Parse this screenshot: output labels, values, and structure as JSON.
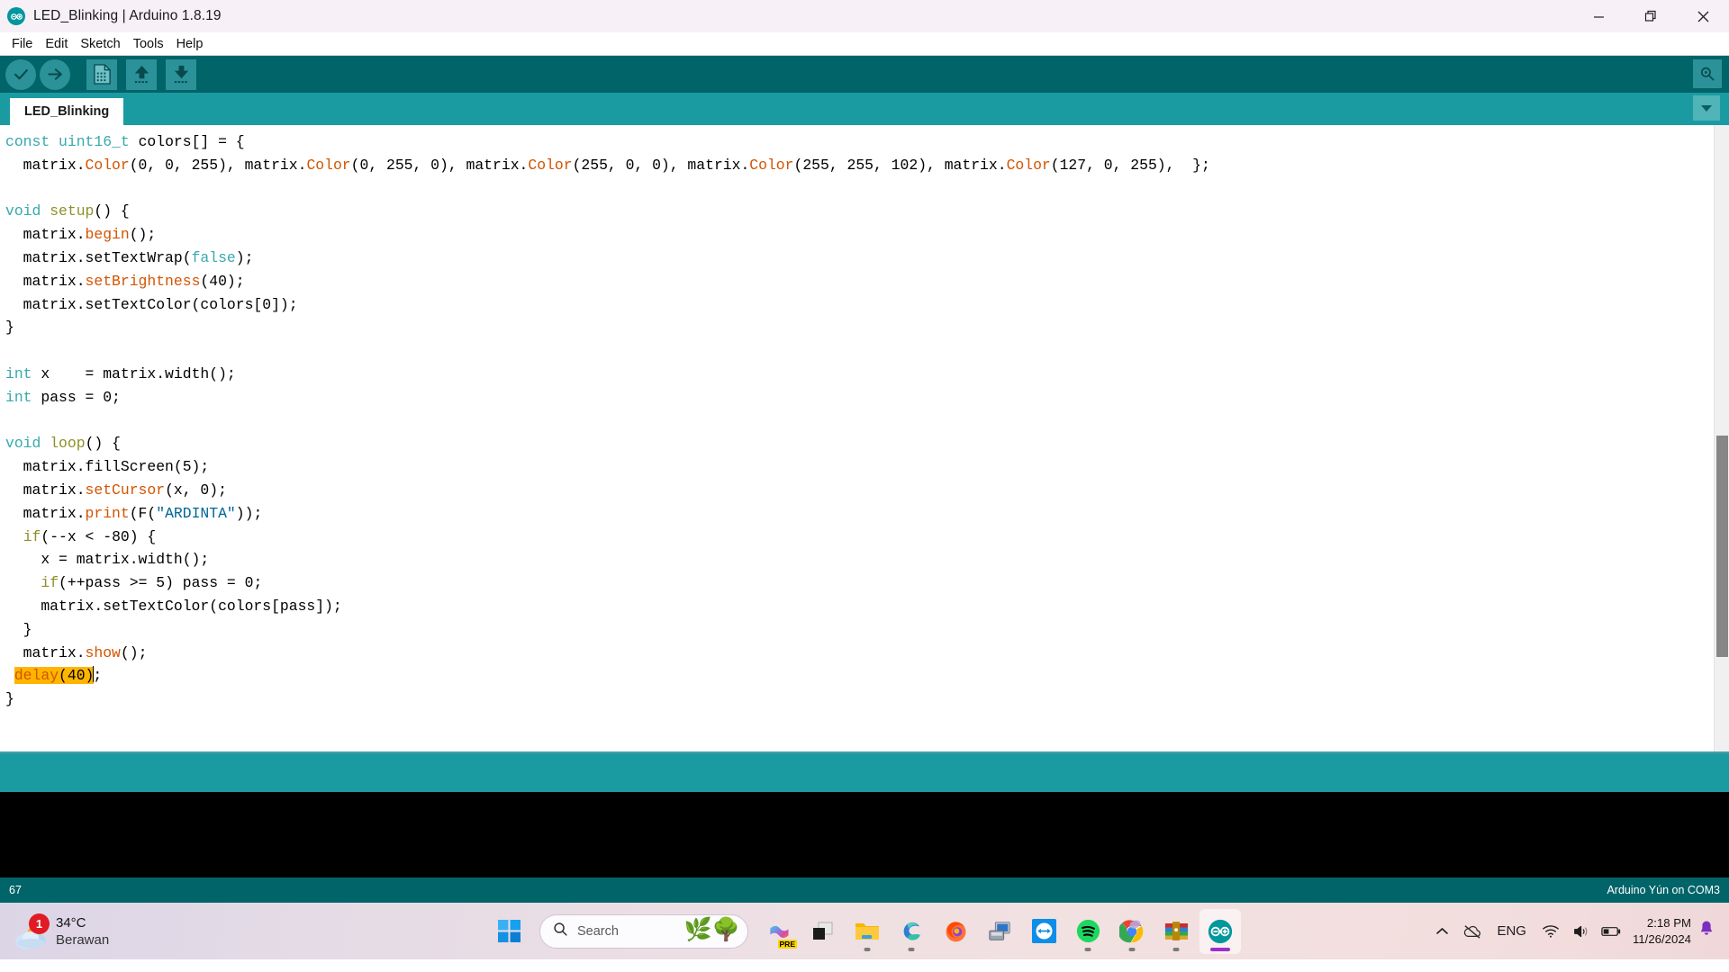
{
  "window": {
    "title": "LED_Blinking | Arduino 1.8.19",
    "logo_icon": "arduino-infinity-icon",
    "minimize_label": "—",
    "restore_icon": "restore-icon",
    "close_label": "×"
  },
  "menubar": {
    "items": [
      {
        "label": "File"
      },
      {
        "label": "Edit"
      },
      {
        "label": "Sketch"
      },
      {
        "label": "Tools"
      },
      {
        "label": "Help"
      }
    ]
  },
  "toolbar": {
    "verify_icon": "check-verify-icon",
    "upload_icon": "arrow-right-upload-icon",
    "new_icon": "new-file-icon",
    "open_icon": "arrow-up-open-icon",
    "save_icon": "arrow-down-save-icon",
    "serial_monitor_icon": "magnifier-serial-monitor-icon"
  },
  "tabs": {
    "items": [
      {
        "label": "LED_Blinking",
        "active": true
      }
    ],
    "dropdown_icon": "chevron-down-icon"
  },
  "editor": {
    "lines": [
      [
        {
          "t": "const",
          "c": "kw"
        },
        {
          "t": " "
        },
        {
          "t": "uint16_t",
          "c": "type"
        },
        {
          "t": " colors[] = {"
        }
      ],
      [
        {
          "t": "  matrix."
        },
        {
          "t": "Color",
          "c": "fn"
        },
        {
          "t": "(0, 0, 255), matrix."
        },
        {
          "t": "Color",
          "c": "fn"
        },
        {
          "t": "(0, 255, 0), matrix."
        },
        {
          "t": "Color",
          "c": "fn"
        },
        {
          "t": "(255, 0, 0), matrix."
        },
        {
          "t": "Color",
          "c": "fn"
        },
        {
          "t": "(255, 255, 102), matrix."
        },
        {
          "t": "Color",
          "c": "fn"
        },
        {
          "t": "(127, 0, 255),  };"
        }
      ],
      [
        {
          "t": ""
        }
      ],
      [
        {
          "t": "void",
          "c": "kw"
        },
        {
          "t": " "
        },
        {
          "t": "setup",
          "c": "fn2"
        },
        {
          "t": "() {"
        }
      ],
      [
        {
          "t": "  matrix."
        },
        {
          "t": "begin",
          "c": "fn"
        },
        {
          "t": "();"
        }
      ],
      [
        {
          "t": "  matrix.setTextWrap("
        },
        {
          "t": "false",
          "c": "kw"
        },
        {
          "t": ");"
        }
      ],
      [
        {
          "t": "  matrix."
        },
        {
          "t": "setBrightness",
          "c": "fn"
        },
        {
          "t": "(40);"
        }
      ],
      [
        {
          "t": "  matrix.setTextColor(colors[0]);"
        }
      ],
      [
        {
          "t": "}"
        }
      ],
      [
        {
          "t": ""
        }
      ],
      [
        {
          "t": "int",
          "c": "kw"
        },
        {
          "t": " x    = matrix.width();"
        }
      ],
      [
        {
          "t": "int",
          "c": "kw"
        },
        {
          "t": " pass = 0;"
        }
      ],
      [
        {
          "t": ""
        }
      ],
      [
        {
          "t": "void",
          "c": "kw"
        },
        {
          "t": " "
        },
        {
          "t": "loop",
          "c": "fn2"
        },
        {
          "t": "() {"
        }
      ],
      [
        {
          "t": "  matrix.fillScreen(5);"
        }
      ],
      [
        {
          "t": "  matrix."
        },
        {
          "t": "setCursor",
          "c": "fn"
        },
        {
          "t": "(x, 0);"
        }
      ],
      [
        {
          "t": "  matrix."
        },
        {
          "t": "print",
          "c": "fn"
        },
        {
          "t": "(F("
        },
        {
          "t": "\"ARDINTA\"",
          "c": "str"
        },
        {
          "t": "));"
        }
      ],
      [
        {
          "t": "  "
        },
        {
          "t": "if",
          "c": "fn2"
        },
        {
          "t": "(--x < -80) {"
        }
      ],
      [
        {
          "t": "    x = matrix.width();"
        }
      ],
      [
        {
          "t": "    "
        },
        {
          "t": "if",
          "c": "fn2"
        },
        {
          "t": "(++pass >= 5) pass = 0;"
        }
      ],
      [
        {
          "t": "    matrix.setTextColor(colors[pass]);"
        }
      ],
      [
        {
          "t": "  }"
        }
      ],
      [
        {
          "t": "  matrix."
        },
        {
          "t": "show",
          "c": "fn"
        },
        {
          "t": "();"
        }
      ],
      [
        {
          "t": " "
        },
        {
          "t": "delay",
          "c": "fn hl"
        },
        {
          "t": "(40)",
          "c": "hl"
        },
        {
          "t": "|"
        },
        {
          "t": ";"
        }
      ],
      [
        {
          "t": "}"
        }
      ]
    ]
  },
  "statusbar": {
    "line_number": "67",
    "board_info": "Arduino Yún on COM3"
  },
  "taskbar": {
    "weather": {
      "badge_count": "1",
      "temperature": "34°C",
      "condition": "Berawan",
      "icon": "cloud-icon"
    },
    "start_icon": "windows-start-icon",
    "search": {
      "icon": "search-icon",
      "placeholder": "Search",
      "decoration_icon": "olive-branch-bonsai-icon"
    },
    "pinned": [
      {
        "name": "copilot-icon",
        "label": "PRE"
      },
      {
        "name": "task-view-icon",
        "running": false
      },
      {
        "name": "file-explorer-icon",
        "running": true
      },
      {
        "name": "microsoft-edge-icon",
        "running": true
      },
      {
        "name": "firefox-icon",
        "running": false
      },
      {
        "name": "remote-desktop-icon",
        "running": false
      },
      {
        "name": "teamviewer-icon",
        "running": false
      },
      {
        "name": "spotify-icon",
        "running": true
      },
      {
        "name": "google-chrome-icon",
        "running": true
      },
      {
        "name": "winrar-icon",
        "running": true
      },
      {
        "name": "arduino-ide-icon",
        "running": true,
        "active": true
      }
    ],
    "tray": {
      "show_hidden_icon": "chevron-up-icon",
      "onedrive_icon": "onedrive-offline-icon",
      "language": "ENG",
      "wifi_icon": "wifi-icon",
      "volume_icon": "speaker-icon",
      "battery_icon": "battery-icon",
      "time": "2:18 PM",
      "date": "11/26/2024",
      "notification_icon": "bell-icon"
    }
  }
}
